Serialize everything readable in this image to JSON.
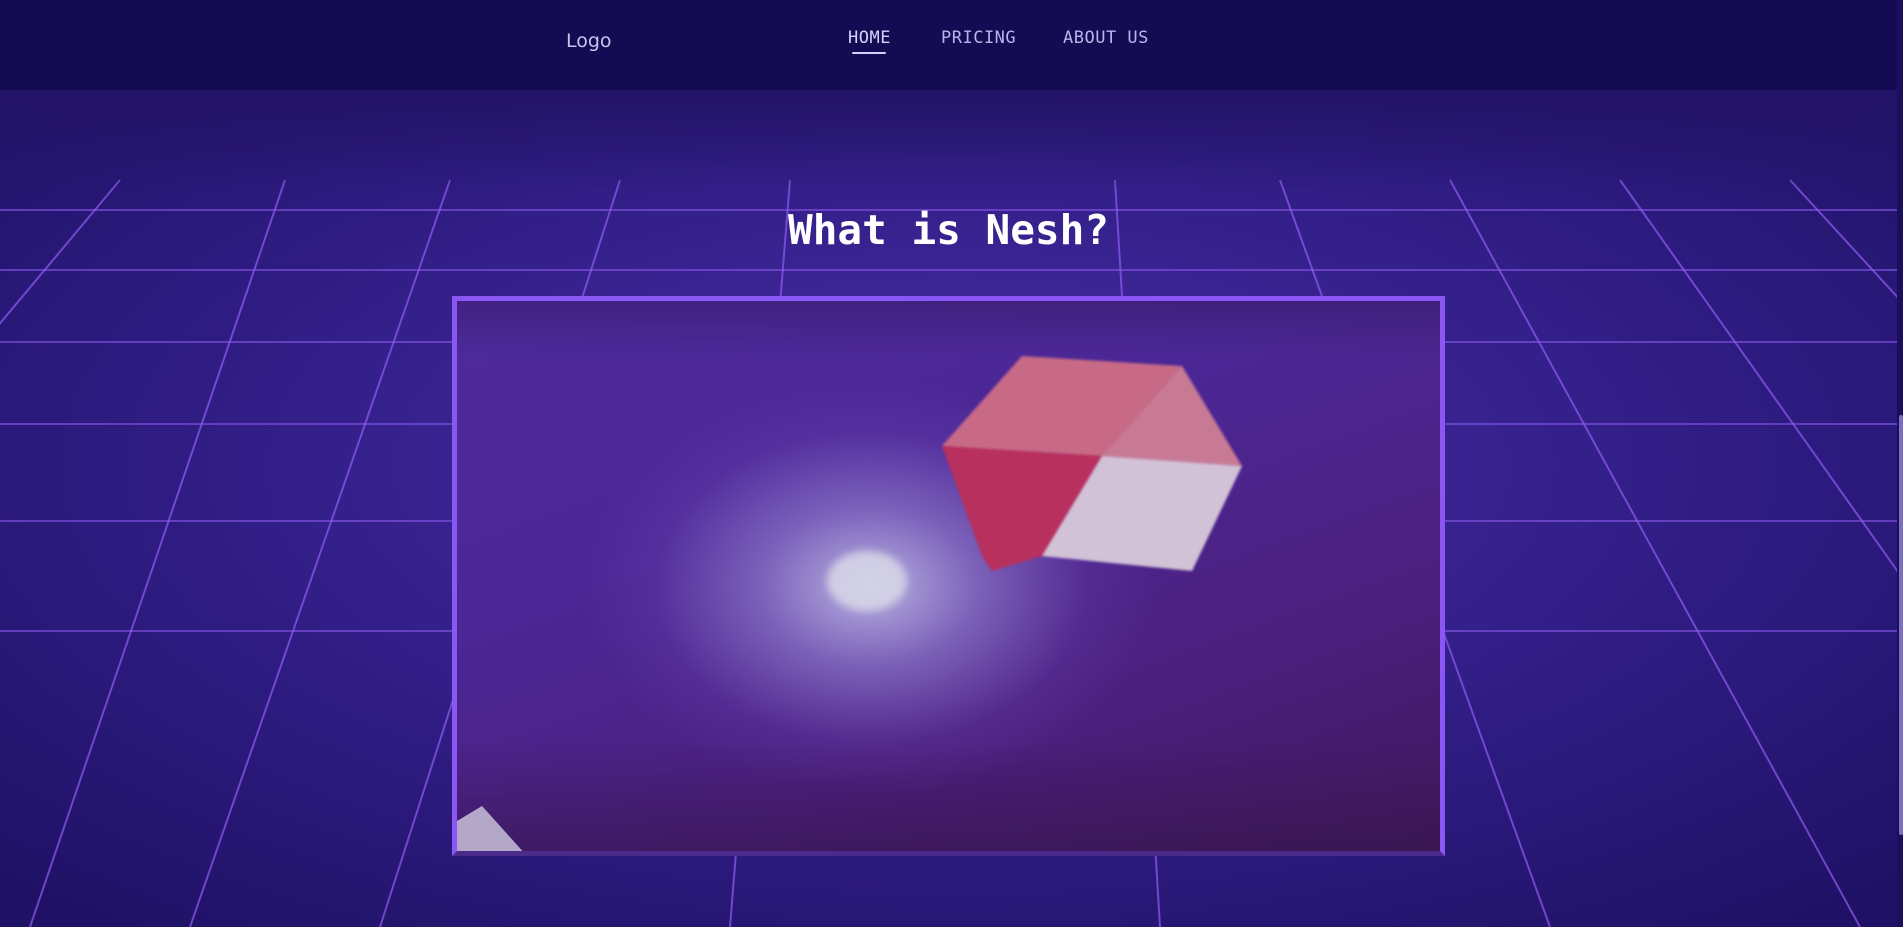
{
  "nav": {
    "logo": "Logo",
    "links": [
      "HOME",
      "PRICING",
      "ABOUT US"
    ],
    "active": "HOME"
  },
  "hero": {
    "title": "What is Nesh?"
  },
  "colors": {
    "navbar_bg": "#150b52",
    "page_bg": "#2a1a78",
    "grid_line": "#8f5cf2",
    "frame_border": "#8a57f5",
    "cube_red": "#c83c6e",
    "cube_light": "#d8c8de"
  },
  "icons": {
    "cube": "cube-graphic"
  }
}
